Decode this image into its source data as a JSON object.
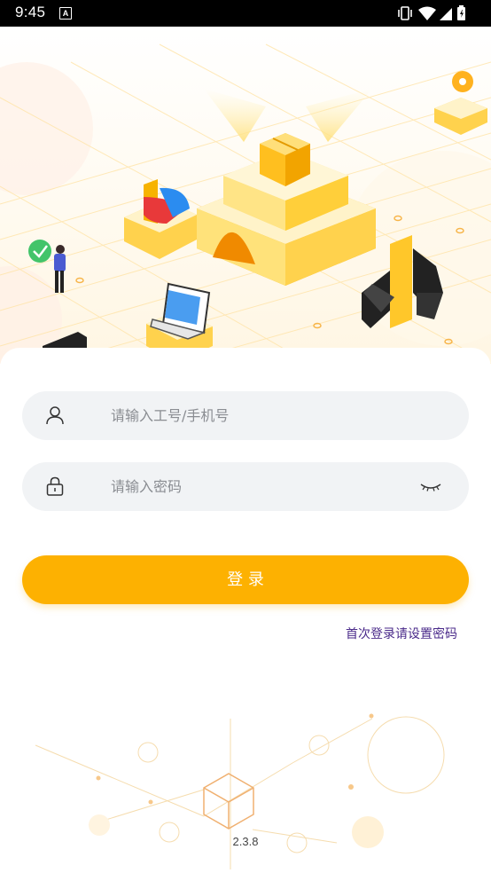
{
  "status_bar": {
    "time": "9:45",
    "notification_icon": "A",
    "icons": [
      "vibrate-icon",
      "wifi-icon",
      "signal-icon",
      "battery-icon"
    ]
  },
  "login": {
    "username_placeholder": "请输入工号/手机号",
    "password_placeholder": "请输入密码",
    "login_button": "登 录",
    "first_login_link": "首次登录请设置密码"
  },
  "footer": {
    "version": "2.3.8"
  },
  "colors": {
    "accent": "#fdb101",
    "link": "#4a2a8a",
    "field_bg": "#f1f3f5"
  }
}
